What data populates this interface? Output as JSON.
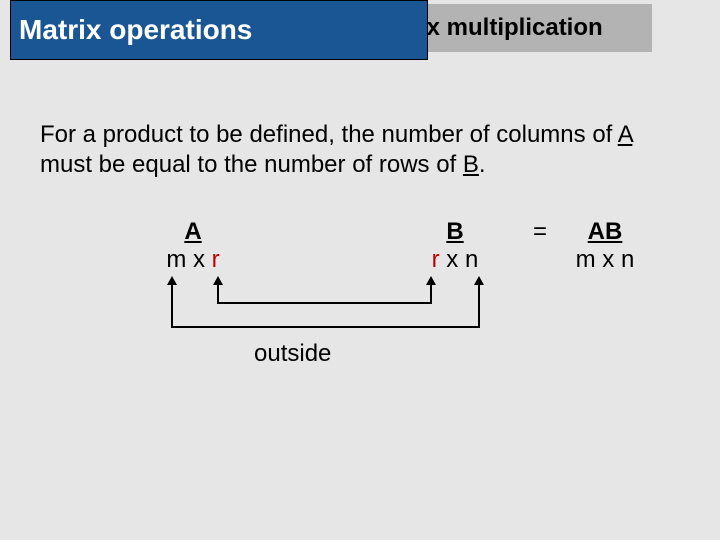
{
  "header": {
    "title_left": "Matrix operations",
    "title_right": "Matrix multiplication"
  },
  "body": {
    "line1_a": "For a product to be defined, the number of columns of ",
    "line1_b": "A",
    "line1_c": " must be equal to the number of rows of ",
    "line1_d": "B",
    "line1_e": "."
  },
  "diagram": {
    "A": {
      "name": "A",
      "m": "m",
      "x": " x ",
      "r": "r"
    },
    "B": {
      "name": "B",
      "r": "r",
      "x": " x ",
      "n": "n"
    },
    "eq": "=",
    "AB": {
      "name": "AB",
      "m": "m",
      "x": " x ",
      "n": "n"
    },
    "outside": "outside"
  }
}
